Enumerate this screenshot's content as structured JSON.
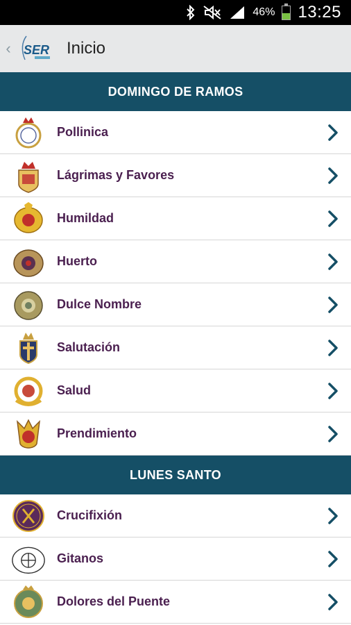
{
  "status_bar": {
    "battery_percent": "46%",
    "battery_level": 0.46,
    "time": "13:25",
    "icons": [
      "bluetooth-icon",
      "mute-icon",
      "signal-icon",
      "battery-icon"
    ]
  },
  "action_bar": {
    "logo_text": "SER",
    "title": "Inicio"
  },
  "sections": [
    {
      "title": "DOMINGO DE RAMOS",
      "items": [
        {
          "label": "Pollinica"
        },
        {
          "label": "Lágrimas y Favores"
        },
        {
          "label": "Humildad"
        },
        {
          "label": "Huerto"
        },
        {
          "label": "Dulce Nombre"
        },
        {
          "label": "Salutación"
        },
        {
          "label": "Salud"
        },
        {
          "label": "Prendimiento"
        }
      ]
    },
    {
      "title": "LUNES SANTO",
      "items": [
        {
          "label": "Crucifixión"
        },
        {
          "label": "Gitanos"
        },
        {
          "label": "Dolores del Puente"
        }
      ]
    }
  ],
  "colors": {
    "section_bg": "#154f66",
    "label": "#4a1f4f",
    "chevron": "#154f66",
    "action_bar_bg": "#e7e8e9"
  }
}
